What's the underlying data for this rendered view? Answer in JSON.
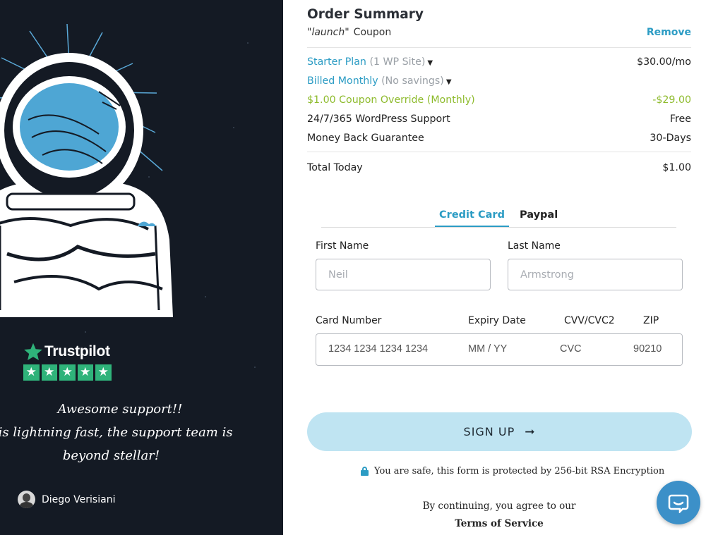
{
  "testimonial": {
    "brand": "Trustpilot",
    "rating_stars": 5,
    "quote_line1": "Awesome support!!",
    "quote_line2": "g is lightning fast, the support team is",
    "quote_line3": "beyond stellar!",
    "reviewer": "Diego Verisiani"
  },
  "order": {
    "title": "Order Summary",
    "coupon_code": "\"launch\"",
    "coupon_label": "Coupon",
    "remove_label": "Remove",
    "plan_name": "Starter Plan",
    "plan_detail": "(1 WP Site)",
    "plan_price": "$30.00/mo",
    "billing_name": "Billed Monthly",
    "billing_detail": "(No savings)",
    "override_label": "$1.00 Coupon Override (Monthly)",
    "override_value": "-$29.00",
    "support_label": "24/7/365 WordPress Support",
    "support_value": "Free",
    "guarantee_label": "Money Back Guarantee",
    "guarantee_value": "30-Days",
    "total_label": "Total Today",
    "total_value": "$1.00"
  },
  "payment": {
    "tabs": [
      {
        "label": "Credit Card",
        "active": true
      },
      {
        "label": "Paypal",
        "active": false
      }
    ],
    "first_name_label": "First Name",
    "first_name_placeholder": "Neil",
    "last_name_label": "Last Name",
    "last_name_placeholder": "Armstrong",
    "card_number_label": "Card Number",
    "expiry_label": "Expiry Date",
    "cvv_label": "CVV/CVC2",
    "zip_label": "ZIP",
    "card_number_placeholder": "1234 1234 1234 1234",
    "expiry_placeholder": "MM / YY",
    "cvv_placeholder": "CVC",
    "zip_placeholder": "90210"
  },
  "actions": {
    "signup_label": "SIGN UP",
    "secure_text": "You are safe, this form is protected by 256-bit RSA Encryption",
    "continue_text": "By continuing, you agree to our",
    "terms_label": "Terms of Service"
  },
  "colors": {
    "accent": "#2c9cc4",
    "coupon_green": "#8ebb2d",
    "button_bg": "#bfe4f2",
    "left_panel_bg": "#141a24",
    "trustpilot_green": "#2fb37a",
    "chat_bubble": "#3c90c8"
  },
  "icons": [
    "astronaut-illustration",
    "trustpilot-star-icon",
    "caret-down-icon",
    "arrow-right-icon",
    "lock-icon",
    "chat-icon",
    "avatar"
  ]
}
